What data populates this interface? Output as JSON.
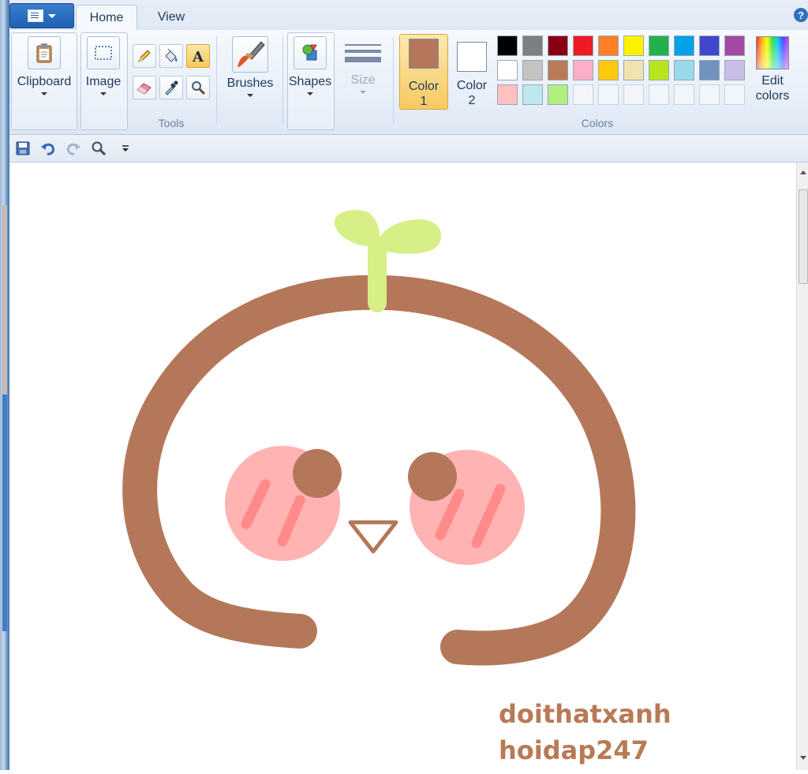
{
  "tabs": {
    "home": "Home",
    "view": "View"
  },
  "help": "?",
  "ribbon": {
    "clipboard": "Clipboard",
    "image": "Image",
    "tools_group": "Tools",
    "brushes": "Brushes",
    "shapes": "Shapes",
    "size": "Size",
    "color1_a": "Color",
    "color1_b": "1",
    "color2_a": "Color",
    "color2_b": "2",
    "colors_group": "Colors",
    "edit_a": "Edit",
    "edit_b": "colors"
  },
  "active_color1": "#b5765a",
  "active_color2": "#ffffff",
  "palette": [
    [
      "#000000",
      "#7f7f7f",
      "#880015",
      "#ed1c24",
      "#ff7f27",
      "#fff200",
      "#22b14c",
      "#00a2e8",
      "#3f48cc",
      "#a349a4"
    ],
    [
      "#ffffff",
      "#c3c3c3",
      "#b97a57",
      "#ffaec9",
      "#ffc90e",
      "#efe4b0",
      "#b5e61d",
      "#99d9ea",
      "#7092be",
      "#c8bfe7"
    ],
    [
      "#ffc0c0",
      "#bde8f0",
      "#b0ee80",
      "",
      "",
      "",
      "",
      "",
      "",
      ""
    ]
  ],
  "drawing_colors": {
    "outline": "#b5775a",
    "sprout": "#d7ef87",
    "cheek": "#ffb3b3",
    "blush": "#ff8a8a"
  },
  "watermark": {
    "line1": "doithatxanh",
    "line2": "hoidap247"
  }
}
